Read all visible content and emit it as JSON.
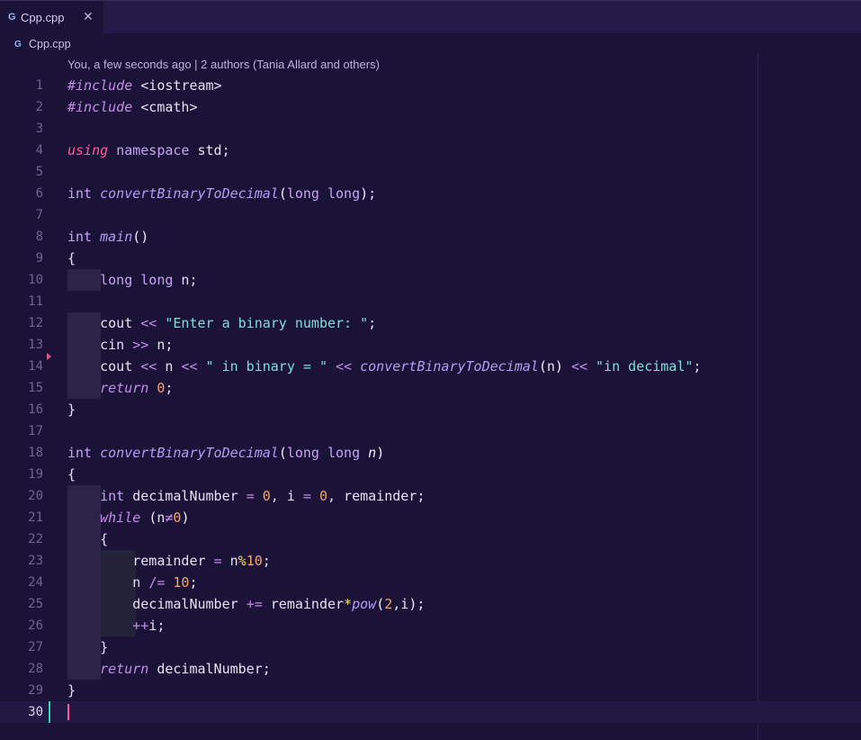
{
  "tab": {
    "icon": "cpp-file-icon",
    "label": "Cpp.cpp",
    "close_glyph": "✕"
  },
  "breadcrumb": {
    "icon": "cpp-file-icon",
    "label": "Cpp.cpp"
  },
  "blame": "You, a few seconds ago | 2 authors (Tania Allard and others)",
  "colors": {
    "background": "#1b1237",
    "tabbar": "#241a47",
    "keyword": "#ff5c95",
    "string": "#7fe0d8",
    "number": "#f5a66e",
    "function": "#b29cf5",
    "modified_gutter": "#3ed1b4",
    "cursor": "#ff5c95"
  },
  "current_line": 30,
  "lines": [
    {
      "n": "1",
      "indent": 0,
      "tokens": [
        [
          "pre",
          "#include"
        ],
        [
          "plain",
          " <iostream>"
        ]
      ]
    },
    {
      "n": "2",
      "indent": 0,
      "tokens": [
        [
          "pre",
          "#include"
        ],
        [
          "plain",
          " <cmath>"
        ]
      ]
    },
    {
      "n": "3",
      "indent": 0,
      "tokens": []
    },
    {
      "n": "4",
      "indent": 0,
      "tokens": [
        [
          "kwi",
          "using"
        ],
        [
          "plain",
          " "
        ],
        [
          "kw",
          "namespace"
        ],
        [
          "plain",
          " std;"
        ]
      ]
    },
    {
      "n": "5",
      "indent": 0,
      "tokens": []
    },
    {
      "n": "6",
      "indent": 0,
      "tokens": [
        [
          "type",
          "int"
        ],
        [
          "plain",
          " "
        ],
        [
          "fn",
          "convertBinaryToDecimal"
        ],
        [
          "par",
          "("
        ],
        [
          "type",
          "long long"
        ],
        [
          "par",
          ")"
        ],
        [
          "plain",
          ";"
        ]
      ]
    },
    {
      "n": "7",
      "indent": 0,
      "tokens": []
    },
    {
      "n": "8",
      "indent": 0,
      "tokens": [
        [
          "type",
          "int"
        ],
        [
          "plain",
          " "
        ],
        [
          "fn",
          "main"
        ],
        [
          "par",
          "()"
        ]
      ]
    },
    {
      "n": "9",
      "indent": 0,
      "tokens": [
        [
          "plain",
          "{"
        ]
      ]
    },
    {
      "n": "10",
      "indent": 1,
      "tokens": [
        [
          "plain",
          "    "
        ],
        [
          "type",
          "long long"
        ],
        [
          "plain",
          " n;"
        ]
      ]
    },
    {
      "n": "11",
      "indent": 0,
      "tokens": []
    },
    {
      "n": "12",
      "indent": 1,
      "tokens": [
        [
          "plain",
          "    cout "
        ],
        [
          "op",
          "<<"
        ],
        [
          "plain",
          " "
        ],
        [
          "str",
          "\"Enter a binary number: \""
        ],
        [
          "plain",
          ";"
        ]
      ]
    },
    {
      "n": "13",
      "indent": 1,
      "tokens": [
        [
          "plain",
          "    cin "
        ],
        [
          "op",
          ">>"
        ],
        [
          "plain",
          " n;"
        ]
      ]
    },
    {
      "n": "14",
      "indent": 1,
      "tokens": [
        [
          "plain",
          "    cout "
        ],
        [
          "op",
          "<<"
        ],
        [
          "plain",
          " n "
        ],
        [
          "op",
          "<<"
        ],
        [
          "plain",
          " "
        ],
        [
          "str",
          "\" in binary = \""
        ],
        [
          "plain",
          " "
        ],
        [
          "op",
          "<<"
        ],
        [
          "plain",
          " "
        ],
        [
          "fn",
          "convertBinaryToDecimal"
        ],
        [
          "par",
          "("
        ],
        [
          "plain",
          "n"
        ],
        [
          "par",
          ")"
        ],
        [
          "plain",
          " "
        ],
        [
          "op",
          "<<"
        ],
        [
          "plain",
          " "
        ],
        [
          "str",
          "\"in decimal\""
        ],
        [
          "plain",
          ";"
        ]
      ]
    },
    {
      "n": "15",
      "indent": 1,
      "tokens": [
        [
          "plain",
          "    "
        ],
        [
          "ctl",
          "return"
        ],
        [
          "plain",
          " "
        ],
        [
          "num",
          "0"
        ],
        [
          "plain",
          ";"
        ]
      ]
    },
    {
      "n": "16",
      "indent": 0,
      "tokens": [
        [
          "plain",
          "}"
        ]
      ]
    },
    {
      "n": "17",
      "indent": 0,
      "tokens": []
    },
    {
      "n": "18",
      "indent": 0,
      "tokens": [
        [
          "type",
          "int"
        ],
        [
          "plain",
          " "
        ],
        [
          "fn",
          "convertBinaryToDecimal"
        ],
        [
          "par",
          "("
        ],
        [
          "type",
          "long long"
        ],
        [
          "plain",
          " "
        ],
        [
          "param",
          "n"
        ],
        [
          "par",
          ")"
        ]
      ]
    },
    {
      "n": "19",
      "indent": 0,
      "tokens": [
        [
          "plain",
          "{"
        ]
      ]
    },
    {
      "n": "20",
      "indent": 1,
      "tokens": [
        [
          "plain",
          "    "
        ],
        [
          "type",
          "int"
        ],
        [
          "plain",
          " decimalNumber "
        ],
        [
          "op",
          "="
        ],
        [
          "plain",
          " "
        ],
        [
          "num",
          "0"
        ],
        [
          "plain",
          ", i "
        ],
        [
          "op",
          "="
        ],
        [
          "plain",
          " "
        ],
        [
          "num",
          "0"
        ],
        [
          "plain",
          ", remainder;"
        ]
      ]
    },
    {
      "n": "21",
      "indent": 1,
      "tokens": [
        [
          "plain",
          "    "
        ],
        [
          "ctl",
          "while"
        ],
        [
          "plain",
          " "
        ],
        [
          "par",
          "("
        ],
        [
          "plain",
          "n"
        ],
        [
          "op",
          "≠"
        ],
        [
          "num",
          "0"
        ],
        [
          "par",
          ")"
        ]
      ]
    },
    {
      "n": "22",
      "indent": 1,
      "tokens": [
        [
          "plain",
          "    {"
        ]
      ]
    },
    {
      "n": "23",
      "indent": 2,
      "tokens": [
        [
          "plain",
          "        remainder "
        ],
        [
          "op",
          "="
        ],
        [
          "plain",
          " n"
        ],
        [
          "yel",
          "%"
        ],
        [
          "num",
          "10"
        ],
        [
          "plain",
          ";"
        ]
      ]
    },
    {
      "n": "24",
      "indent": 2,
      "tokens": [
        [
          "plain",
          "        n "
        ],
        [
          "op",
          "/="
        ],
        [
          "plain",
          " "
        ],
        [
          "num",
          "10"
        ],
        [
          "plain",
          ";"
        ]
      ]
    },
    {
      "n": "25",
      "indent": 2,
      "tokens": [
        [
          "plain",
          "        decimalNumber "
        ],
        [
          "op",
          "+="
        ],
        [
          "plain",
          " remainder"
        ],
        [
          "yel",
          "*"
        ],
        [
          "fn",
          "pow"
        ],
        [
          "par",
          "("
        ],
        [
          "num",
          "2"
        ],
        [
          "plain",
          ",i"
        ],
        [
          "par",
          ")"
        ],
        [
          "plain",
          ";"
        ]
      ]
    },
    {
      "n": "26",
      "indent": 2,
      "tokens": [
        [
          "plain",
          "        "
        ],
        [
          "op",
          "++"
        ],
        [
          "plain",
          "i;"
        ]
      ]
    },
    {
      "n": "27",
      "indent": 1,
      "tokens": [
        [
          "plain",
          "    }"
        ]
      ]
    },
    {
      "n": "28",
      "indent": 1,
      "tokens": [
        [
          "plain",
          "    "
        ],
        [
          "ctl",
          "return"
        ],
        [
          "plain",
          " decimalNumber;"
        ]
      ]
    },
    {
      "n": "29",
      "indent": 0,
      "tokens": [
        [
          "plain",
          "}"
        ]
      ]
    },
    {
      "n": "30",
      "indent": 0,
      "tokens": []
    }
  ]
}
